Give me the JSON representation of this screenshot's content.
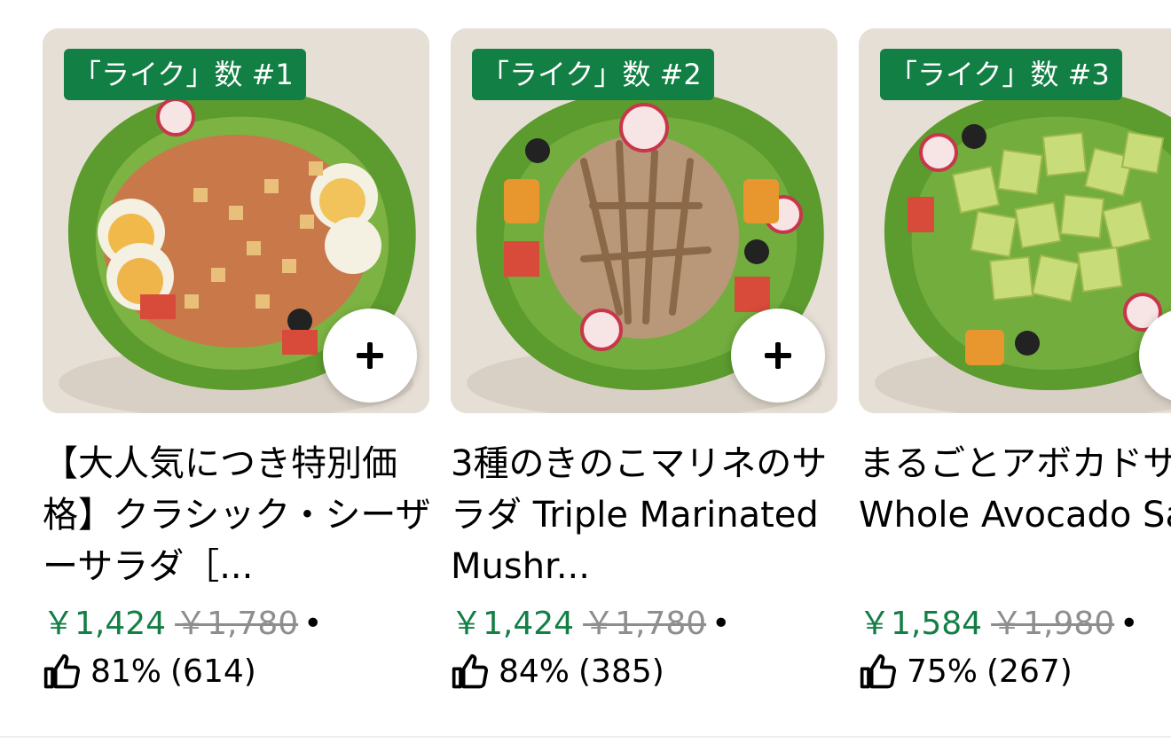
{
  "items": [
    {
      "rank_badge": "「ライク」数 #1",
      "title": "【大人気につき特別価格】クラシック・シーザーサラダ［...",
      "price": "￥1,424",
      "original_price": "￥1,780",
      "separator": "•",
      "rating_percent": "81%",
      "rating_count": "(614)",
      "image_icon": "classic-caesar-salad-photo"
    },
    {
      "rank_badge": "「ライク」数 #2",
      "title": "3種のきのこマリネのサラダ Triple Marinated Mushr...",
      "price": "￥1,424",
      "original_price": "￥1,780",
      "separator": "•",
      "rating_percent": "84%",
      "rating_count": "(385)",
      "image_icon": "mushroom-marinade-salad-photo"
    },
    {
      "rank_badge": "「ライク」数 #3",
      "title": "まるごとアボカドサラダ Whole Avocado Salad",
      "price": "￥1,584",
      "original_price": "￥1,980",
      "separator": "•",
      "rating_percent": "75%",
      "rating_count": "(267)",
      "image_icon": "whole-avocado-salad-photo"
    }
  ],
  "icons": {
    "add": "plus-icon",
    "like": "thumbs-up-icon"
  },
  "colors": {
    "accent_green": "#127f45",
    "strike_gray": "#8e8e8e",
    "badge_text": "#ffffff"
  }
}
